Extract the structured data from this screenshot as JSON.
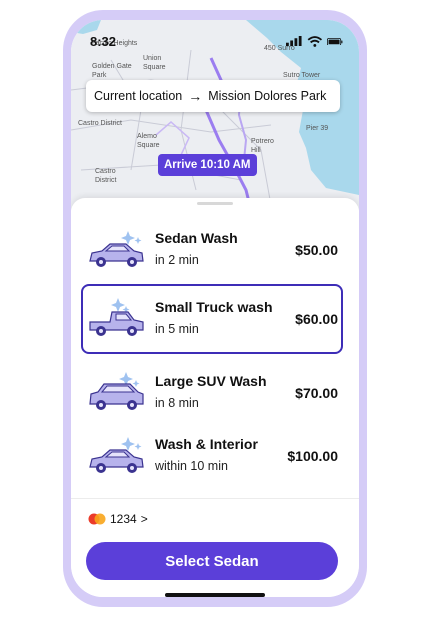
{
  "status_bar": {
    "time": "8:32"
  },
  "map": {
    "labels": {
      "pacific_heights": "Pacific Heights",
      "golden_gate_park": "Golden Gate Park",
      "union_square": "Union Square",
      "surro": "450 Surro",
      "sutro_tower": "Sutro Tower",
      "castro_district_top": "Castro District",
      "alemo_square": "Alemo Square",
      "potrero_hill": "Potrero Hill",
      "pier_39": "Pier 39",
      "castro_district": "Castro District"
    },
    "route": {
      "from": "Current location",
      "to": "Mission Dolores Park"
    },
    "arrive": "Arrive 10:10 AM"
  },
  "options": [
    {
      "name": "Sedan Wash",
      "eta": "in 2 min",
      "price": "$50.00",
      "selected": false
    },
    {
      "name": "Small Truck wash",
      "eta": "in 5 min",
      "price": "$60.00",
      "selected": true
    },
    {
      "name": "Large SUV Wash",
      "eta": "in 8 min",
      "price": "$70.00",
      "selected": false
    },
    {
      "name": "Wash & Interior",
      "eta": "within 10 min",
      "price": "$100.00",
      "selected": false
    }
  ],
  "payment": {
    "card_last4": "1234",
    "chevron": ">"
  },
  "cta": {
    "label": "Select Sedan"
  },
  "colors": {
    "accent": "#5b3fd9",
    "selected_border": "#3d2db7",
    "phone_frame": "#d5ccf7",
    "water": "#a9d8ec",
    "map_land": "#eceef2",
    "route_line": "#9b7df0"
  },
  "icons": [
    "signal-icon",
    "wifi-icon",
    "battery-icon",
    "arrow-right-icon",
    "car-icon",
    "truck-icon",
    "suv-icon",
    "mastercard-icon",
    "chevron-right-icon"
  ]
}
